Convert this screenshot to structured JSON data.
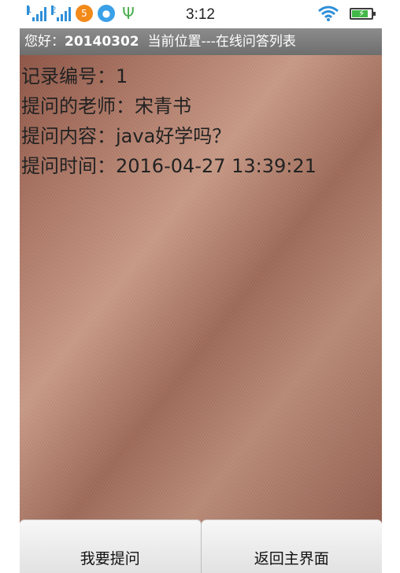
{
  "status_bar": {
    "time": "3:12",
    "signal1_label": "1",
    "signal2_label": "2",
    "notification_badge": "5",
    "battery_percent": 85
  },
  "titlebar": {
    "greeting": "您好：",
    "user_id": "20140302",
    "location_label": "当前位置---在线问答列表"
  },
  "record": {
    "id_label": "记录编号：",
    "id_value": "1",
    "teacher_label": "提问的老师：",
    "teacher_value": "宋青书",
    "question_label": "提问内容：",
    "question_value": "java好学吗？",
    "time_label": "提问时间：",
    "time_value": "2016-04-27 13:39:21"
  },
  "buttons": {
    "ask_label": "我要提问",
    "home_label": "返回主界面"
  },
  "colors": {
    "titlebar_bg": "#7d7d7d",
    "button_bg": "#ececec",
    "signal": "#2f8fd8",
    "battery": "#42b848"
  }
}
